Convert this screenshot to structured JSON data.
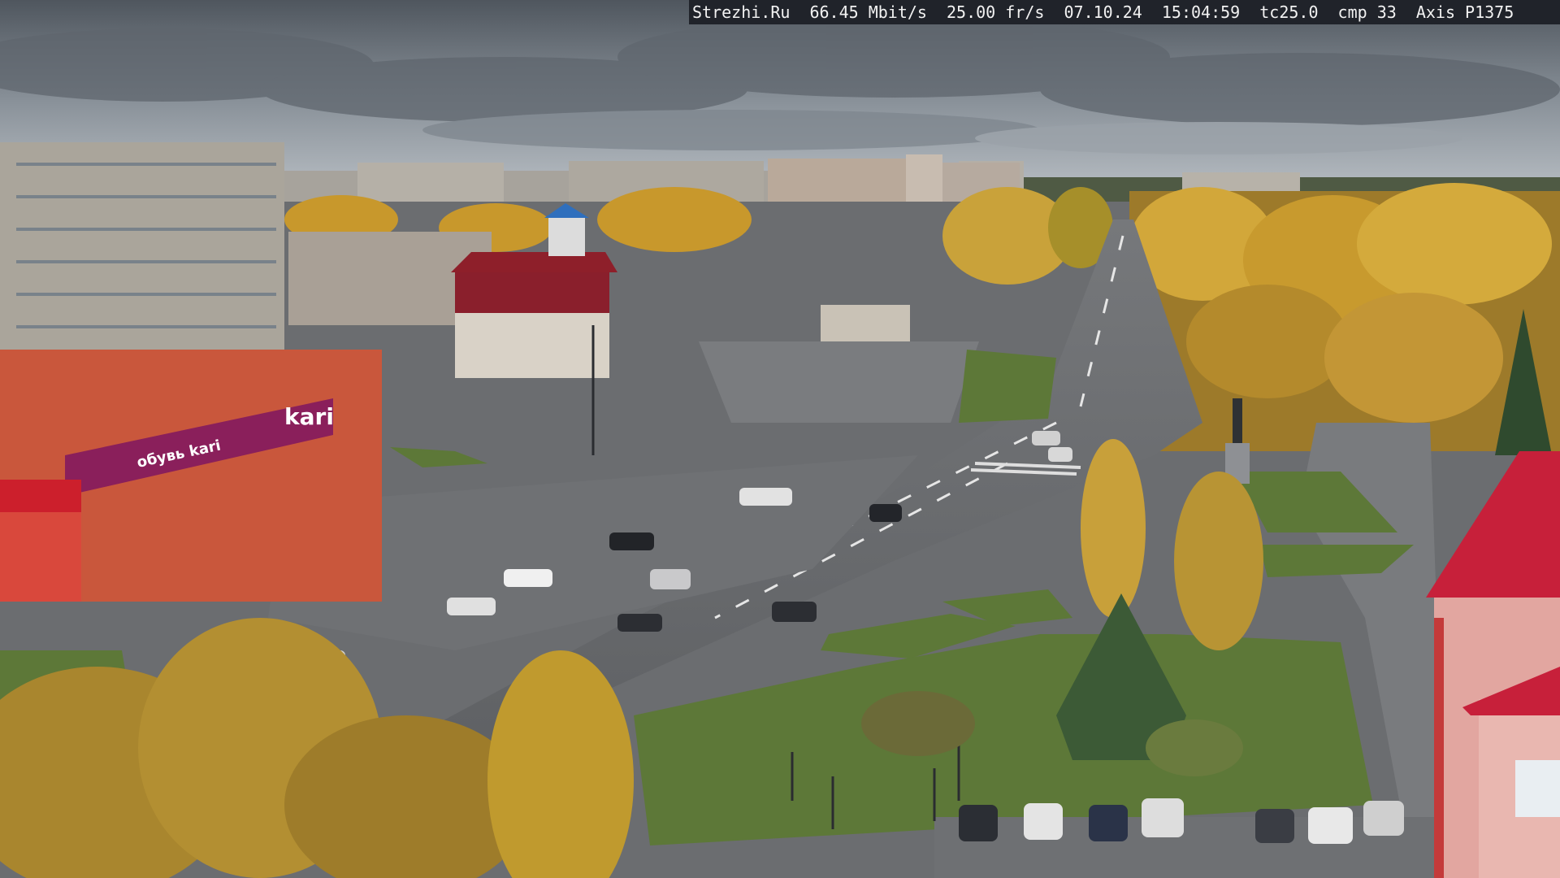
{
  "overlay": {
    "site": "Strezhi.Ru",
    "bitrate": "66.45 Mbit/s",
    "framerate": "25.00 fr/s",
    "date": "07.10.24",
    "time": "15:04:59",
    "tc": "tc25.0",
    "cmp": "cmp 33",
    "camera": "Axis P1375"
  },
  "signs": {
    "store_logo": "kari",
    "store_banner": "обувь kari"
  },
  "colors": {
    "sky": "#8e969e",
    "clouds": "#5d646c",
    "asphalt": "#6a6c6f",
    "grass": "#5e7a3a",
    "autumn_foliage": "#d3a632",
    "store_facade": "#c9573c",
    "store_banner": "#8a1f5b",
    "red_roof": "#c7203a"
  }
}
